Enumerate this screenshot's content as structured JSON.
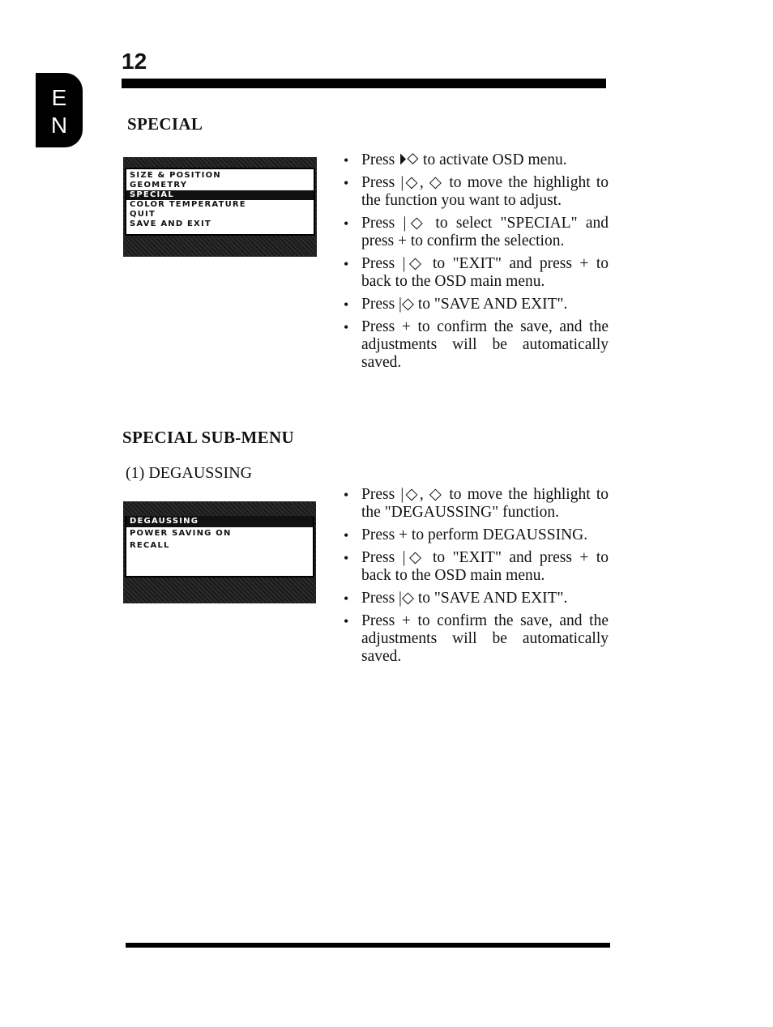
{
  "page": {
    "number": "12",
    "language_tab": [
      "E",
      "N"
    ]
  },
  "special": {
    "heading": "SPECIAL",
    "osd_menu": {
      "items": [
        {
          "label": "SIZE & POSITION",
          "highlighted": false
        },
        {
          "label": "GEOMETRY",
          "highlighted": false
        },
        {
          "label": "SPECIAL",
          "highlighted": true
        },
        {
          "label": "COLOR TEMPERATURE",
          "highlighted": false
        },
        {
          "label": "QUIT",
          "highlighted": false
        },
        {
          "label": "SAVE AND EXIT",
          "highlighted": false
        }
      ]
    },
    "instructions": [
      "Press ⏵◇ to activate OSD menu.",
      "Press |◇, ◇ to move the highlight to the function you want to adjust.",
      "Press |◇ to select \"SPECIAL\" and press + to confirm the selection.",
      "Press |◇ to \"EXIT\" and press + to back to the OSD main menu.",
      "Press |◇ to \"SAVE AND EXIT\".",
      "Press + to confirm the save, and the adjustments will be automatically saved."
    ]
  },
  "special_submenu": {
    "heading": "SPECIAL SUB-MENU",
    "subheading": "(1) DEGAUSSING",
    "osd_menu": {
      "items": [
        {
          "label": "DEGAUSSING",
          "highlighted": true
        },
        {
          "label": "POWER SAVING ON",
          "highlighted": false
        },
        {
          "label": "RECALL",
          "highlighted": false
        }
      ]
    },
    "instructions": [
      "Press |◇, ◇ to move the highlight to the \"DEGAUSSING\" function.",
      "Press + to perform DEGAUSSING.",
      "Press |◇ to \"EXIT\" and press + to back to the OSD main menu.",
      "Press |◇ to \"SAVE AND EXIT\".",
      "Press + to confirm the save, and the adjustments will be automatically saved."
    ]
  }
}
